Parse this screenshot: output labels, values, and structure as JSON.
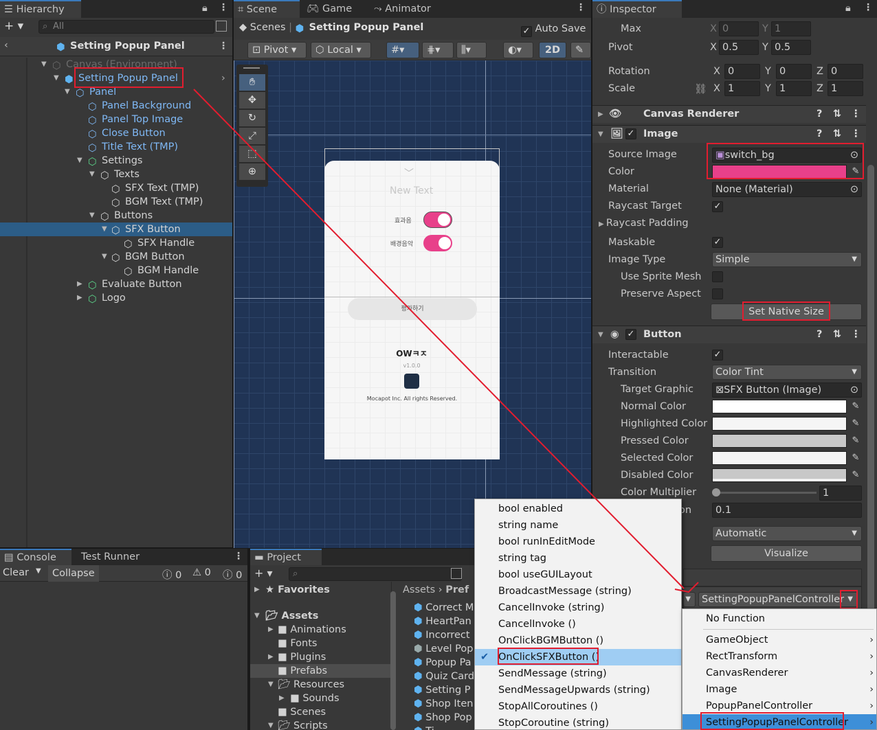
{
  "hierarchy": {
    "tab": "Hierarchy",
    "search_placeholder": "All",
    "header": "Setting Popup Panel",
    "items": [
      "Canvas (Environment)",
      "Setting Popup Panel",
      "Panel",
      "Panel Background",
      "Panel Top Image",
      "Close Button",
      "Title Text (TMP)",
      "Settings",
      "Texts",
      "SFX Text (TMP)",
      "BGM Text (TMP)",
      "Buttons",
      "SFX Button",
      "SFX Handle",
      "BGM Button",
      "BGM Handle",
      "Evaluate Button",
      "Logo"
    ]
  },
  "scene": {
    "tabs": [
      "Scene",
      "Game",
      "Animator"
    ],
    "breadcrumb_root": "Scenes",
    "breadcrumb_current": "Setting Popup Panel",
    "auto_save": "Auto Save",
    "pivot": "Pivot",
    "local": "Local",
    "mode_2d": "2D"
  },
  "preview": {
    "new_text": "New Text",
    "sfx_label": "효과음",
    "bgm_label": "배경음악",
    "evaluate": "평가하기",
    "logo": "OWㅋㅈ",
    "version": "v1.0.0",
    "copyright": "Mocapot Inc. All rights Reserved."
  },
  "inspector": {
    "tab": "Inspector",
    "rect": {
      "max_label": "Max",
      "max_x": "0",
      "max_y": "1",
      "pivot_label": "Pivot",
      "pivot_x": "0.5",
      "pivot_y": "0.5",
      "rotation_label": "Rotation",
      "rot_x": "0",
      "rot_y": "0",
      "rot_z": "0",
      "scale_label": "Scale",
      "scale_x": "1",
      "scale_y": "1",
      "scale_z": "1"
    },
    "canvas_renderer": "Canvas Renderer",
    "image": {
      "title": "Image",
      "source_image_label": "Source Image",
      "source_image": "switch_bg",
      "color_label": "Color",
      "color": "#e8408a",
      "material_label": "Material",
      "material": "None (Material)",
      "raycast_target": "Raycast Target",
      "raycast_padding": "Raycast Padding",
      "maskable": "Maskable",
      "image_type_label": "Image Type",
      "image_type": "Simple",
      "use_sprite_mesh": "Use Sprite Mesh",
      "preserve_aspect": "Preserve Aspect",
      "set_native_size": "Set Native Size"
    },
    "button": {
      "title": "Button",
      "interactable": "Interactable",
      "transition_label": "Transition",
      "transition": "Color Tint",
      "target_graphic_label": "Target Graphic",
      "target_graphic": "SFX Button (Image)",
      "normal": "Normal Color",
      "highlighted": "Highlighted Color",
      "pressed": "Pressed Color",
      "selected": "Selected Color",
      "disabled": "Disabled Color",
      "multiplier": "Color Multiplier",
      "multiplier_value": "1",
      "fade_suffix": "on",
      "fade_value": "0.1",
      "navigation": "Automatic",
      "visualize": "Visualize",
      "runtime_tail": "",
      "function_dropdown": "SettingPopupPanelController"
    }
  },
  "console": {
    "tabs": [
      "Console",
      "Test Runner"
    ],
    "clear": "Clear",
    "collapse": "Collapse",
    "counts": [
      "0",
      "0",
      "0"
    ]
  },
  "project": {
    "tab": "Project",
    "favorites": "Favorites",
    "assets": "Assets",
    "folders": [
      "Animations",
      "Fonts",
      "Plugins",
      "Prefabs",
      "Resources",
      "Sounds",
      "Scenes",
      "Scripts"
    ],
    "breadcrumb": [
      "Assets",
      "Pref"
    ],
    "files": [
      "Correct M",
      "HeartPan",
      "Incorrect",
      "Level Pop",
      "Popup Pa",
      "Quiz Card",
      "Setting P",
      "Shop Iten",
      "Shop Pop",
      "Ti"
    ]
  },
  "method_menu": {
    "items": [
      "bool enabled",
      "string name",
      "bool runInEditMode",
      "string tag",
      "bool useGUILayout",
      "BroadcastMessage (string)",
      "CancelInvoke (string)",
      "CancelInvoke ()",
      "OnClickBGMButton ()",
      "OnClickSFXButton ()",
      "SendMessage (string)",
      "SendMessageUpwards (string)",
      "StopAllCoroutines ()",
      "StopCoroutine (string)"
    ],
    "checked_index": 9
  },
  "component_menu": {
    "items": [
      "No Function",
      "GameObject",
      "RectTransform",
      "CanvasRenderer",
      "Image",
      "PopupPanelController",
      "SettingPopupPanelController"
    ]
  },
  "accent": "#3a79bb",
  "highlight": "#e21d2f"
}
